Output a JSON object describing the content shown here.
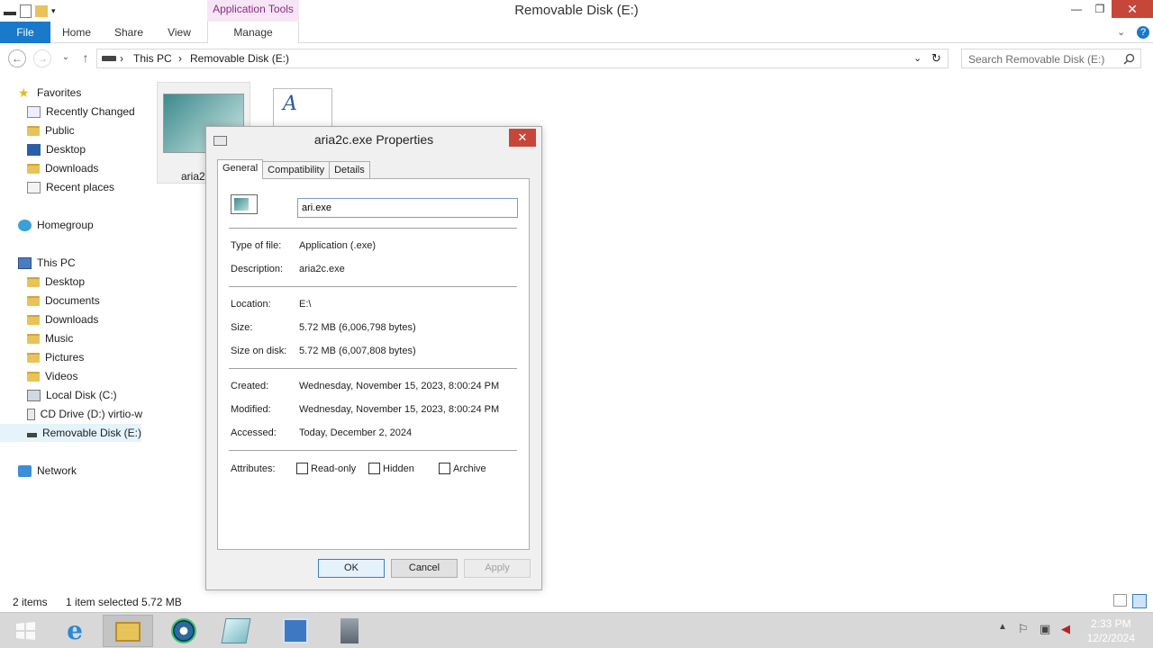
{
  "window": {
    "title": "Removable Disk (E:)",
    "context_tab": "Application Tools",
    "controls": {
      "minimize": "—",
      "restore": "❐",
      "close": "✕"
    }
  },
  "ribbon": {
    "tabs": [
      "File",
      "Home",
      "Share",
      "View",
      "Manage"
    ],
    "expand": "⌄",
    "help": "?"
  },
  "address": {
    "back": "←",
    "forward": "→",
    "recent": "⌄",
    "up": "↑",
    "path": [
      "This PC",
      "Removable Disk (E:)"
    ],
    "sep": "›",
    "dropdown": "⌄",
    "refresh": "↻",
    "search_placeholder": "Search Removable Disk (E:)",
    "search_icon": "search-icon"
  },
  "sidebar": {
    "favorites": {
      "label": "Favorites",
      "items": [
        "Recently Changed",
        "Public",
        "Desktop",
        "Downloads",
        "Recent places"
      ]
    },
    "homegroup": {
      "label": "Homegroup"
    },
    "thispc": {
      "label": "This PC",
      "items": [
        "Desktop",
        "Documents",
        "Downloads",
        "Music",
        "Pictures",
        "Videos",
        "Local Disk (C:)",
        "CD Drive (D:) virtio-w",
        "Removable Disk (E:)"
      ]
    },
    "network": {
      "label": "Network"
    }
  },
  "content": {
    "files": [
      {
        "name": "aria2",
        "type": "application"
      },
      {
        "name": "",
        "type": "document"
      }
    ]
  },
  "status": {
    "items": "2 items",
    "selected": "1 item selected  5.72 MB"
  },
  "dialog": {
    "title": "aria2c.exe Properties",
    "close": "✕",
    "tabs": [
      "General",
      "Compatibility",
      "Details"
    ],
    "filename": "ari.exe",
    "rows": {
      "type": {
        "label": "Type of file:",
        "value": "Application (.exe)"
      },
      "description": {
        "label": "Description:",
        "value": "aria2c.exe"
      },
      "location": {
        "label": "Location:",
        "value": "E:\\"
      },
      "size": {
        "label": "Size:",
        "value": "5.72 MB (6,006,798 bytes)"
      },
      "size_on_disk": {
        "label": "Size on disk:",
        "value": "5.72 MB (6,007,808 bytes)"
      },
      "created": {
        "label": "Created:",
        "value": "Wednesday, November 15, 2023, 8:00:24 PM"
      },
      "modified": {
        "label": "Modified:",
        "value": "Wednesday, November 15, 2023, 8:00:24 PM"
      },
      "accessed": {
        "label": "Accessed:",
        "value": "Today, December 2, 2024"
      }
    },
    "attributes": {
      "label": "Attributes:",
      "readonly": "Read-only",
      "hidden": "Hidden",
      "archive": "Archive"
    },
    "buttons": {
      "ok": "OK",
      "cancel": "Cancel",
      "apply": "Apply"
    }
  },
  "taskbar": {
    "time": "2:33 PM",
    "date": "12/2/2024",
    "apps": [
      "start",
      "internet-explorer",
      "file-explorer",
      "network-app",
      "notepad-app",
      "control-panel",
      "server-manager"
    ]
  },
  "colors": {
    "accent": "#1979ca",
    "close_red": "#c7463a",
    "context_tab": "#f6e6f5",
    "selection": "#e5f3fb"
  }
}
